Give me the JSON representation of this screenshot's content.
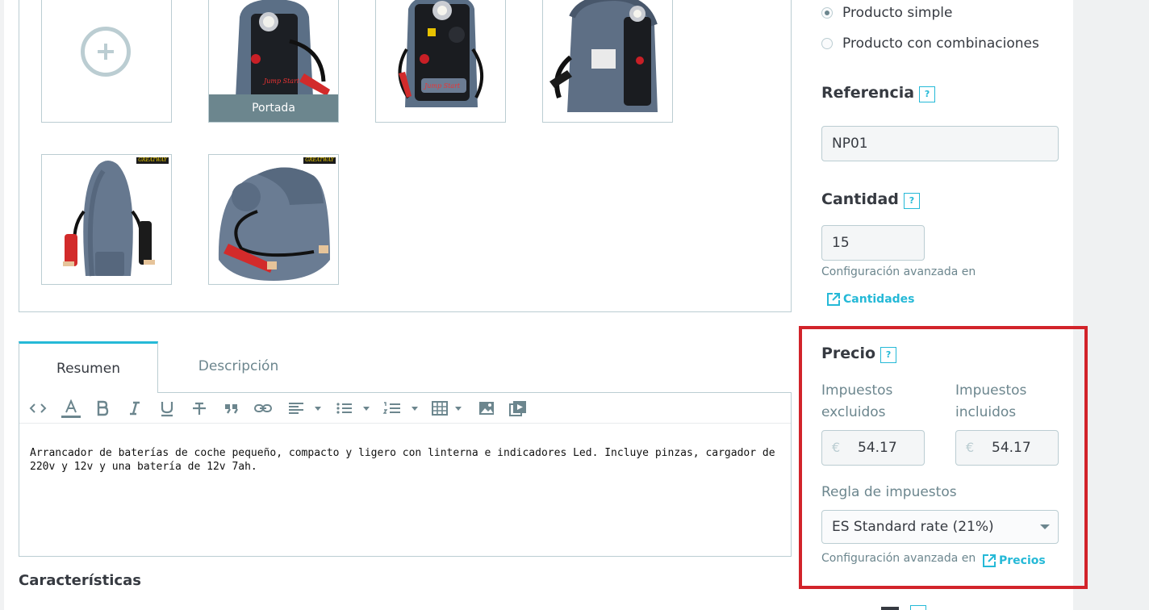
{
  "gallery": {
    "cover_label": "Portada",
    "brand_mark": "GREATWAY"
  },
  "product_type": {
    "simple": "Producto simple",
    "combinations": "Producto con combinaciones",
    "selected": "simple"
  },
  "reference": {
    "label": "Referencia",
    "help": "?",
    "value": "NP01"
  },
  "quantity": {
    "label": "Cantidad",
    "help": "?",
    "value": "15",
    "advanced_note": "Configuración avanzada en",
    "advanced_link": "Cantidades"
  },
  "tabs": [
    {
      "label": "Resumen",
      "active": true
    },
    {
      "label": "Descripción",
      "active": false
    }
  ],
  "editor": {
    "text": "Arrancador de baterías de coche pequeño, compacto y ligero con linterna e indicadores Led. Incluye pinzas, cargador de 220v y 12v y una batería de 12v 7ah."
  },
  "features": {
    "title": "Características"
  },
  "price": {
    "label": "Precio",
    "help": "?",
    "tax_excl_label": "Impuestos excluidos",
    "tax_incl_label": "Impuestos incluidos",
    "currency": "€",
    "tax_excl_value": "54.17",
    "tax_incl_value": "54.17",
    "tax_rule_label": "Regla de impuestos",
    "tax_rule_value": "ES Standard rate (21%)",
    "advanced_note": "Configuración avanzada en",
    "advanced_link": "Precios"
  },
  "colors": {
    "accent": "#25b9d7",
    "highlight": "#d2232a",
    "border": "#bbcdd2",
    "muted": "#6c868e"
  }
}
